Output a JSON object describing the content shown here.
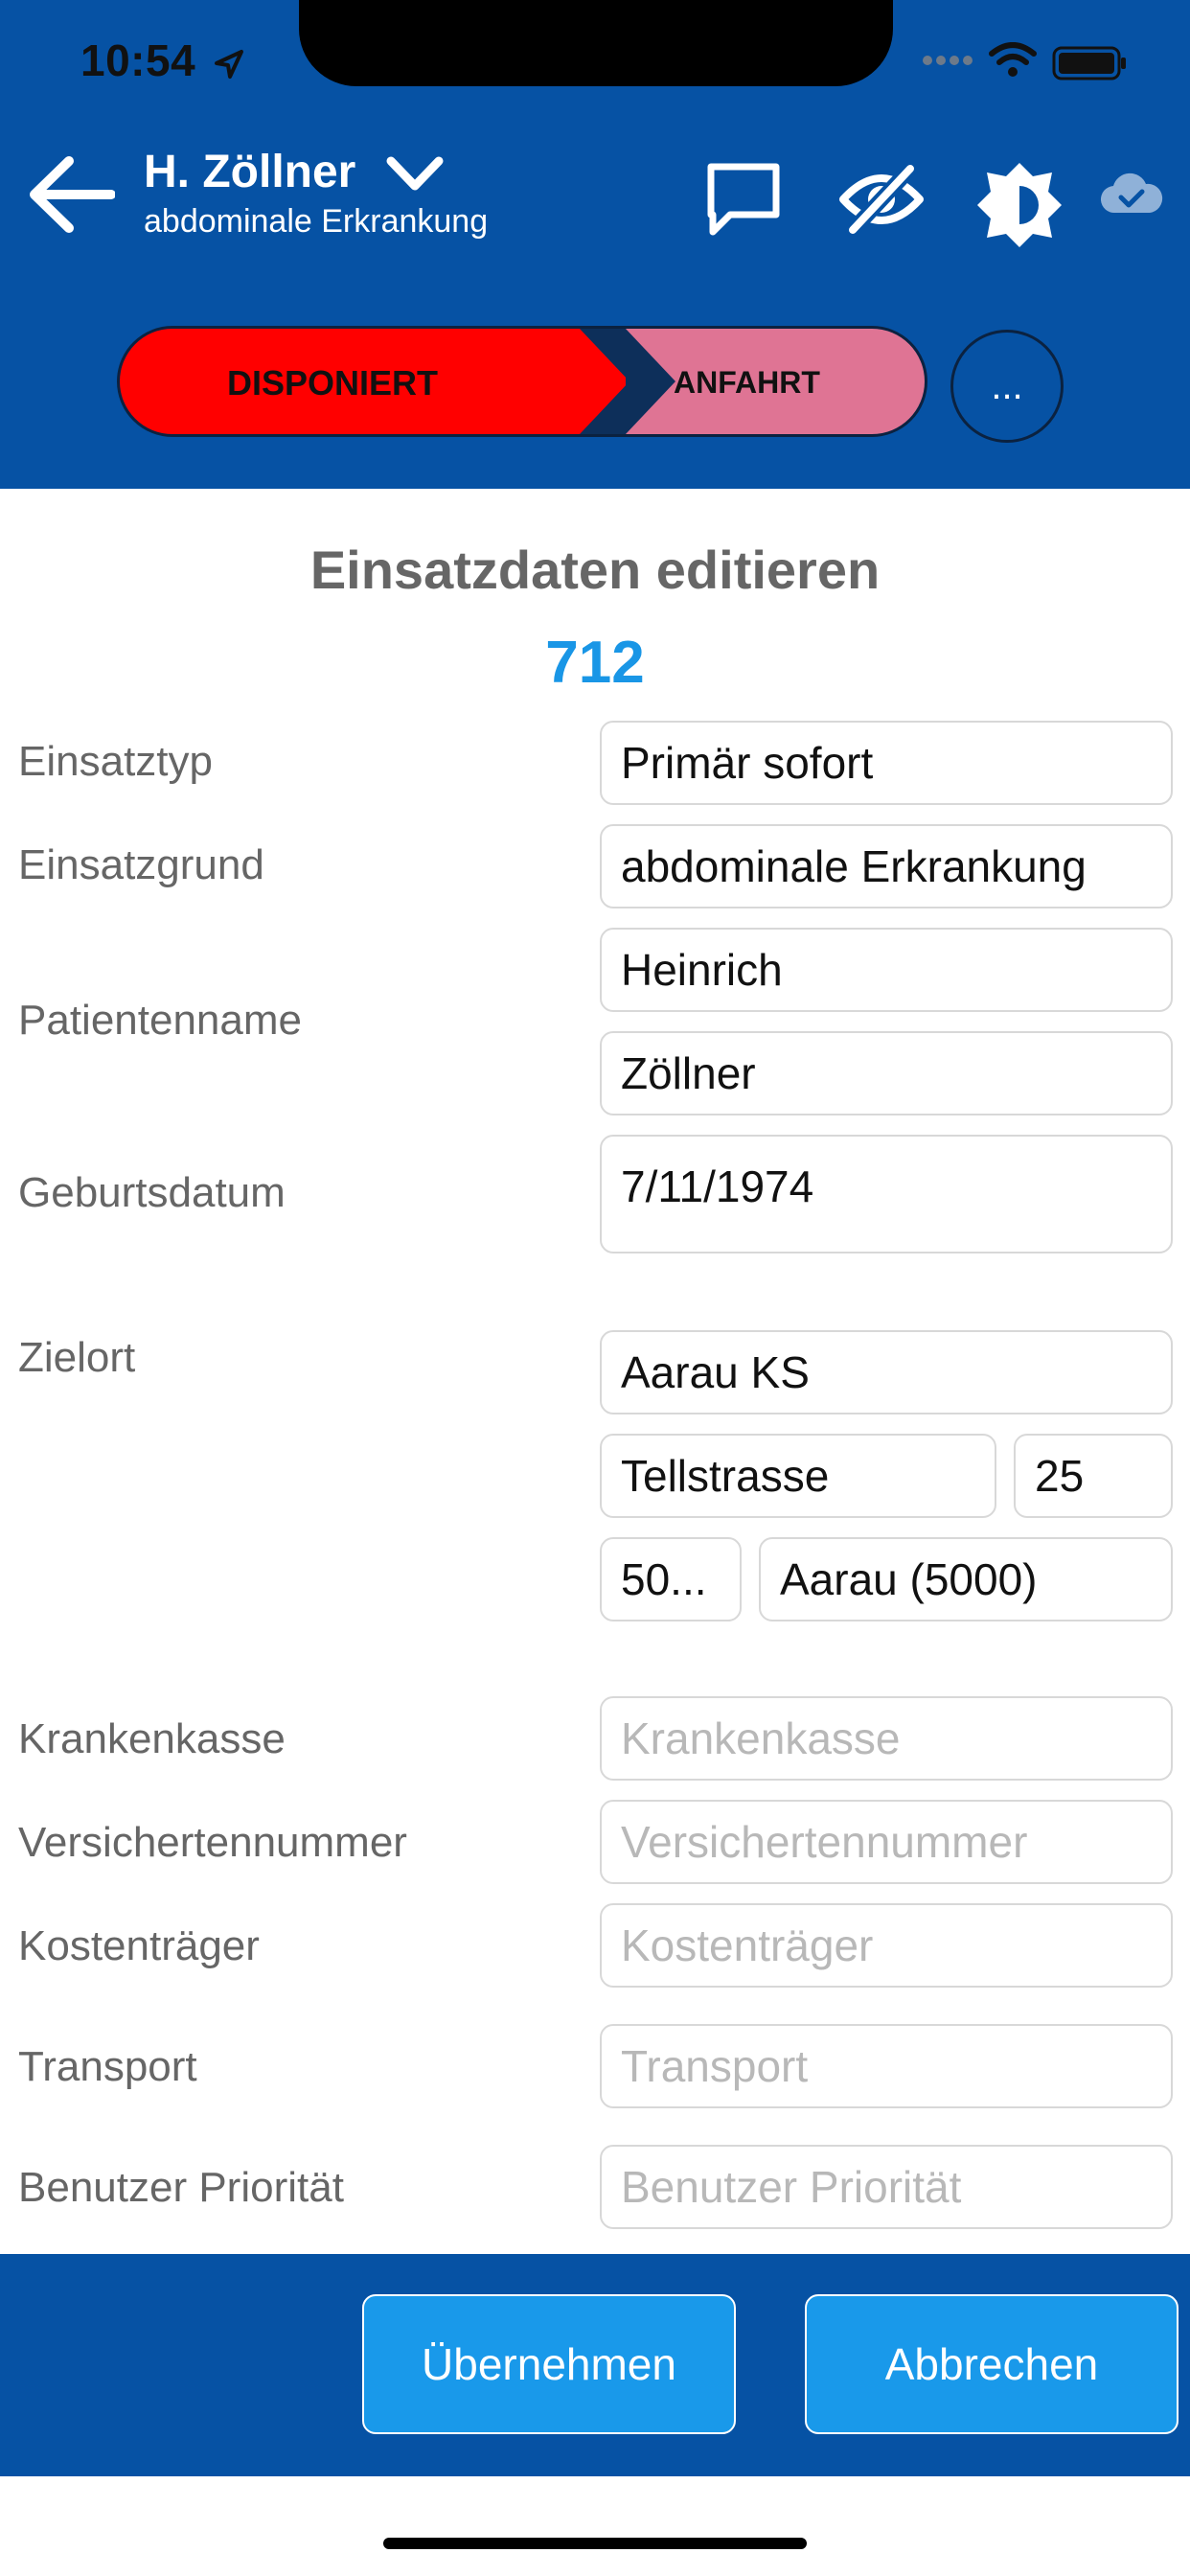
{
  "status_bar": {
    "time": "10:54"
  },
  "header": {
    "title": "H. Zöllner",
    "subtitle": "abdominale Erkrankung",
    "status_steps": [
      "DISPONIERT",
      "ANFAHRT"
    ],
    "more_label": "..."
  },
  "form": {
    "title": "Einsatzdaten editieren",
    "number": "712",
    "labels": {
      "einsatztyp": "Einsatztyp",
      "einsatzgrund": "Einsatzgrund",
      "patientenname": "Patientenname",
      "geburtsdatum": "Geburtsdatum",
      "zielort": "Zielort",
      "krankenkasse": "Krankenkasse",
      "versichertennummer": "Versichertennummer",
      "kostentraeger": "Kostenträger",
      "transport": "Transport",
      "benutzer_prioritaet": "Benutzer Priorität"
    },
    "values": {
      "einsatztyp": "Primär sofort",
      "einsatzgrund": "abdominale Erkrankung",
      "vorname": "Heinrich",
      "nachname": "Zöllner",
      "geburtsdatum": "7/11/1974",
      "zielort_name": "Aarau KS",
      "strasse": "Tellstrasse",
      "hausnummer": "25",
      "plz": "50...",
      "ort": "Aarau (5000)"
    },
    "placeholders": {
      "krankenkasse": "Krankenkasse",
      "versichertennummer": "Versichertennummer",
      "kostentraeger": "Kostenträger",
      "transport": "Transport",
      "benutzer_prioritaet": "Benutzer Priorität"
    }
  },
  "footer": {
    "apply_label": "Übernehmen",
    "cancel_label": "Abbrechen"
  },
  "colors": {
    "header_bg": "#0652a4",
    "step_active": "#ff0000",
    "step_next": "#df7494",
    "accent": "#1996e6"
  }
}
